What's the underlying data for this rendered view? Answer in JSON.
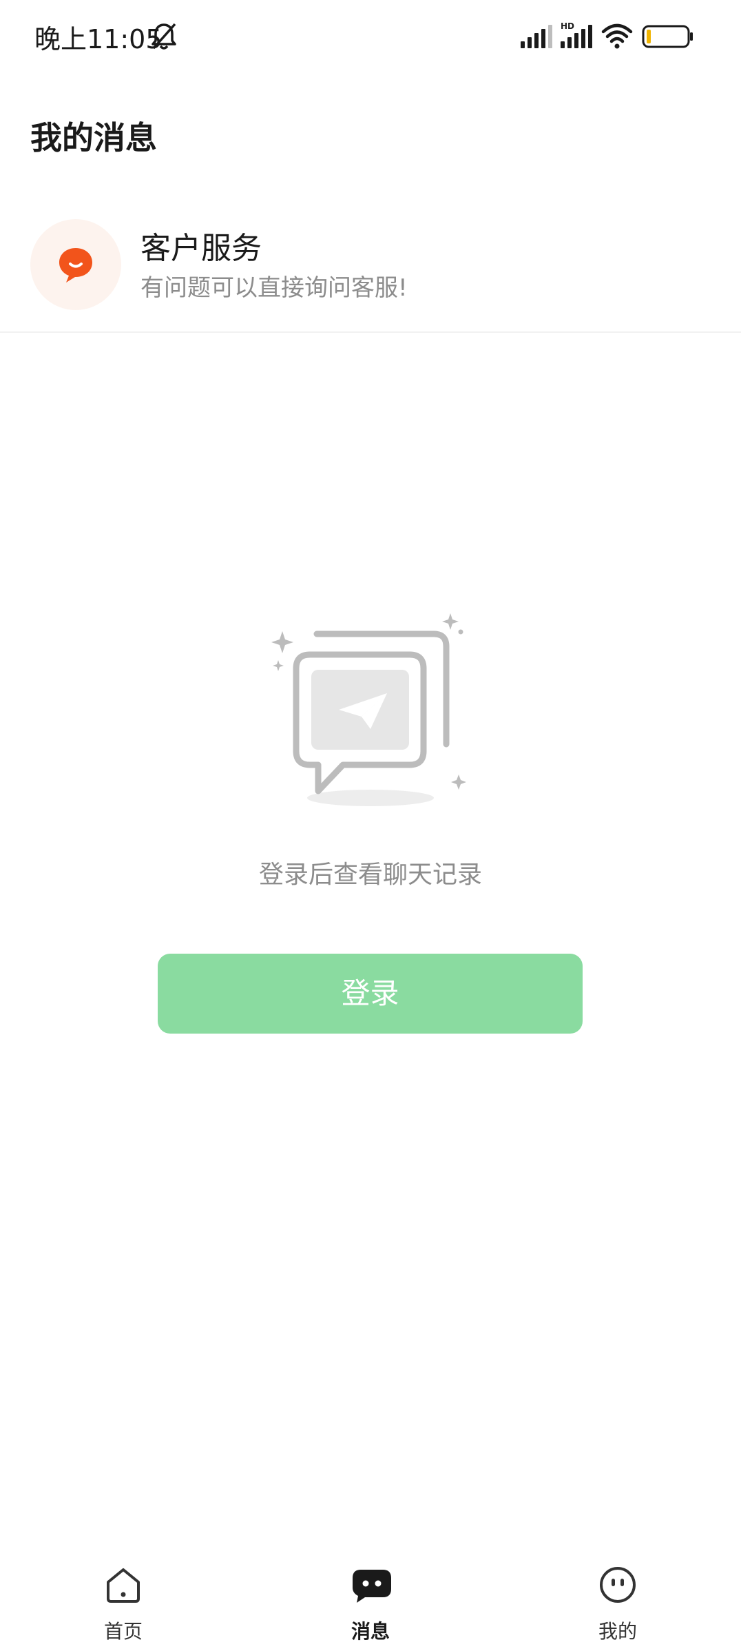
{
  "status_bar": {
    "time": "晚上11:05",
    "icons": [
      "bell-off-icon",
      "signal-icon",
      "hd-signal-icon",
      "wifi-icon",
      "battery-icon"
    ]
  },
  "header": {
    "title": "我的消息"
  },
  "customer_service": {
    "name": "客户服务",
    "description": "有问题可以直接询问客服!",
    "icon": "chat-bubble-icon",
    "icon_color": "#f2541b"
  },
  "empty_state": {
    "icon": "paper-plane-chat-icon",
    "message": "登录后查看聊天记录",
    "login_button_label": "登录",
    "login_button_color": "#8adba0"
  },
  "bottom_nav": {
    "items": [
      {
        "label": "首页",
        "icon": "home-icon",
        "active": false
      },
      {
        "label": "消息",
        "icon": "message-icon",
        "active": true
      },
      {
        "label": "我的",
        "icon": "profile-icon",
        "active": false
      }
    ]
  }
}
